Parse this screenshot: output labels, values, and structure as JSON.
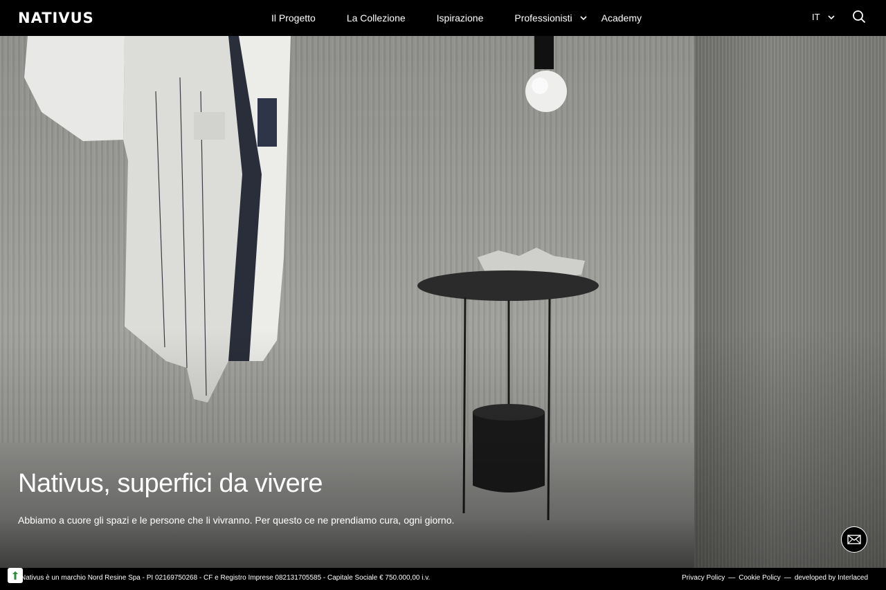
{
  "header": {
    "logo": "NATIVUS",
    "nav": [
      {
        "label": "Il Progetto"
      },
      {
        "label": "La Collezione"
      },
      {
        "label": "Ispirazione"
      },
      {
        "label": "Professionisti"
      },
      {
        "label": "Academy"
      }
    ],
    "language": "IT"
  },
  "hero": {
    "title": "Nativus, superfici da vivere",
    "subtitle": "Abbiamo a cuore gli spazi e le persone che li vivranno. Per questo ce ne prendiamo cura, ogni giorno."
  },
  "footer": {
    "legal": "Nativus è un marchio Nord Resine Spa - PI 02169750268 - CF e Registro Imprese 082131705585 - Capitale Sociale € 750.000,00 i.v.",
    "privacy": "Privacy Policy",
    "cookie": "Cookie Policy",
    "developed": "developed by Interlaced",
    "separator": "—"
  },
  "icons": {
    "search": "search-icon",
    "chevron": "chevron-down-icon",
    "mail": "mail-icon",
    "cookie": "cookie-settings-icon"
  },
  "colors": {
    "header_bg": "#000000",
    "text": "#ffffff"
  }
}
